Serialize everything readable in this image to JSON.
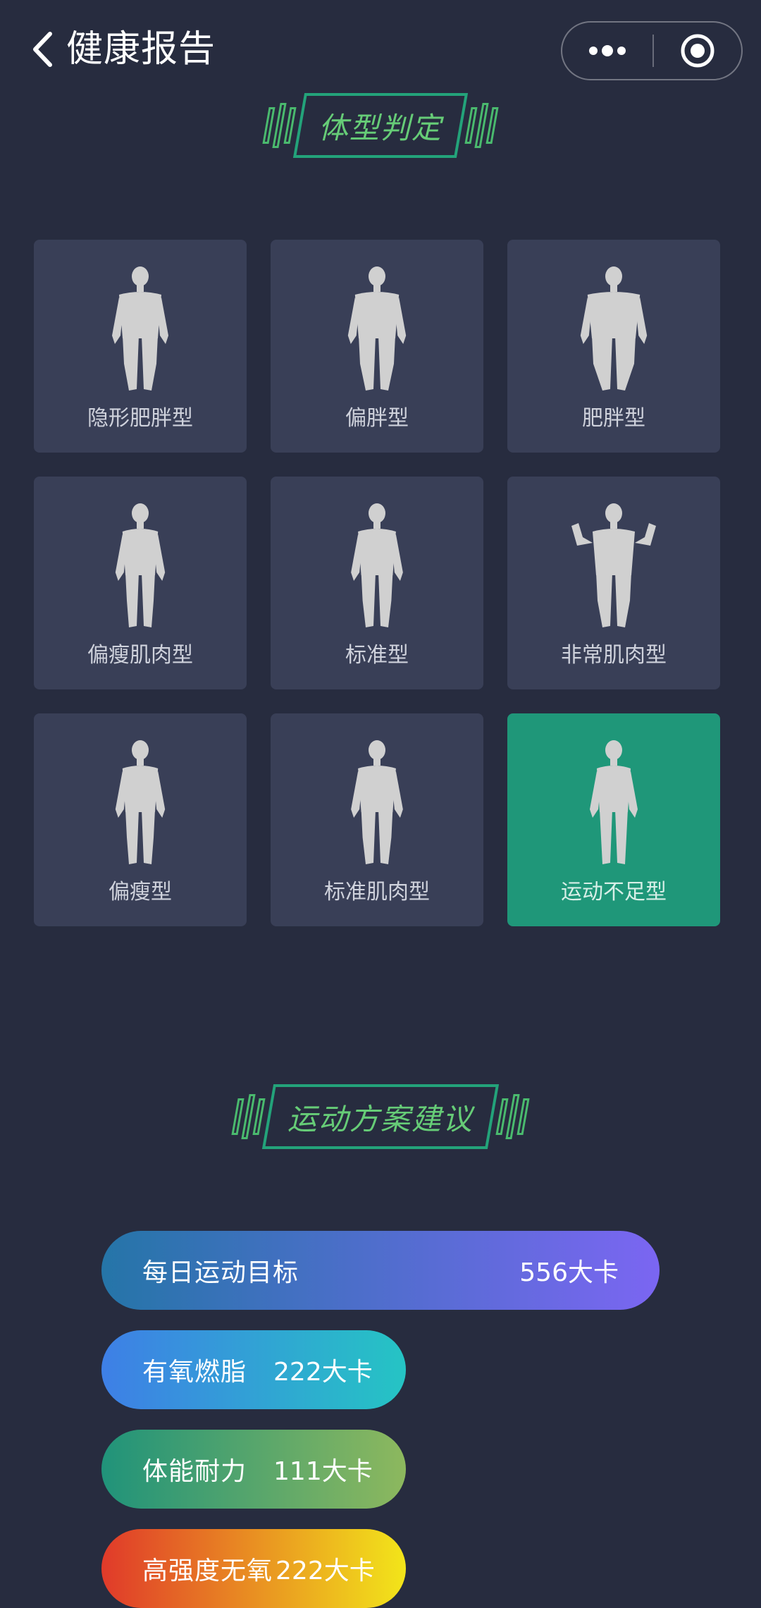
{
  "header": {
    "title": "健康报告",
    "back_icon": "chevron-left-icon",
    "more_icon": "more-dots-icon",
    "target_icon": "target-circle-icon"
  },
  "body_type": {
    "section_title": "体型判定",
    "items": [
      {
        "label": "隐形肥胖型",
        "figure": "slightly-heavy",
        "selected": false
      },
      {
        "label": "偏胖型",
        "figure": "heavy",
        "selected": false
      },
      {
        "label": "肥胖型",
        "figure": "obese",
        "selected": false
      },
      {
        "label": "偏瘦肌肉型",
        "figure": "slim",
        "selected": false
      },
      {
        "label": "标准型",
        "figure": "standard",
        "selected": false
      },
      {
        "label": "非常肌肉型",
        "figure": "flexing",
        "selected": false
      },
      {
        "label": "偏瘦型",
        "figure": "slim",
        "selected": false
      },
      {
        "label": "标准肌肉型",
        "figure": "standard",
        "selected": false
      },
      {
        "label": "运动不足型",
        "figure": "thin",
        "selected": true
      }
    ],
    "colors": {
      "card": "#393f57",
      "selected": "#1f9779"
    }
  },
  "exercise_plan": {
    "section_title": "运动方案建议",
    "goal": {
      "label": "每日运动目标",
      "value": "556大卡"
    },
    "items": [
      {
        "label": "有氧燃脂",
        "value": "222大卡"
      },
      {
        "label": "体能耐力",
        "value": "111大卡"
      },
      {
        "label": "高强度无氧",
        "value": "222大卡"
      }
    ],
    "gradients": {
      "goal": [
        "#2575a8",
        "#7b66f2"
      ],
      "aerobic": [
        "#3e7fe6",
        "#25c4c4"
      ],
      "endurance": [
        "#20937a",
        "#8db85e"
      ],
      "anaerobic": [
        "#e03a2a",
        "#f2e51a"
      ]
    }
  }
}
